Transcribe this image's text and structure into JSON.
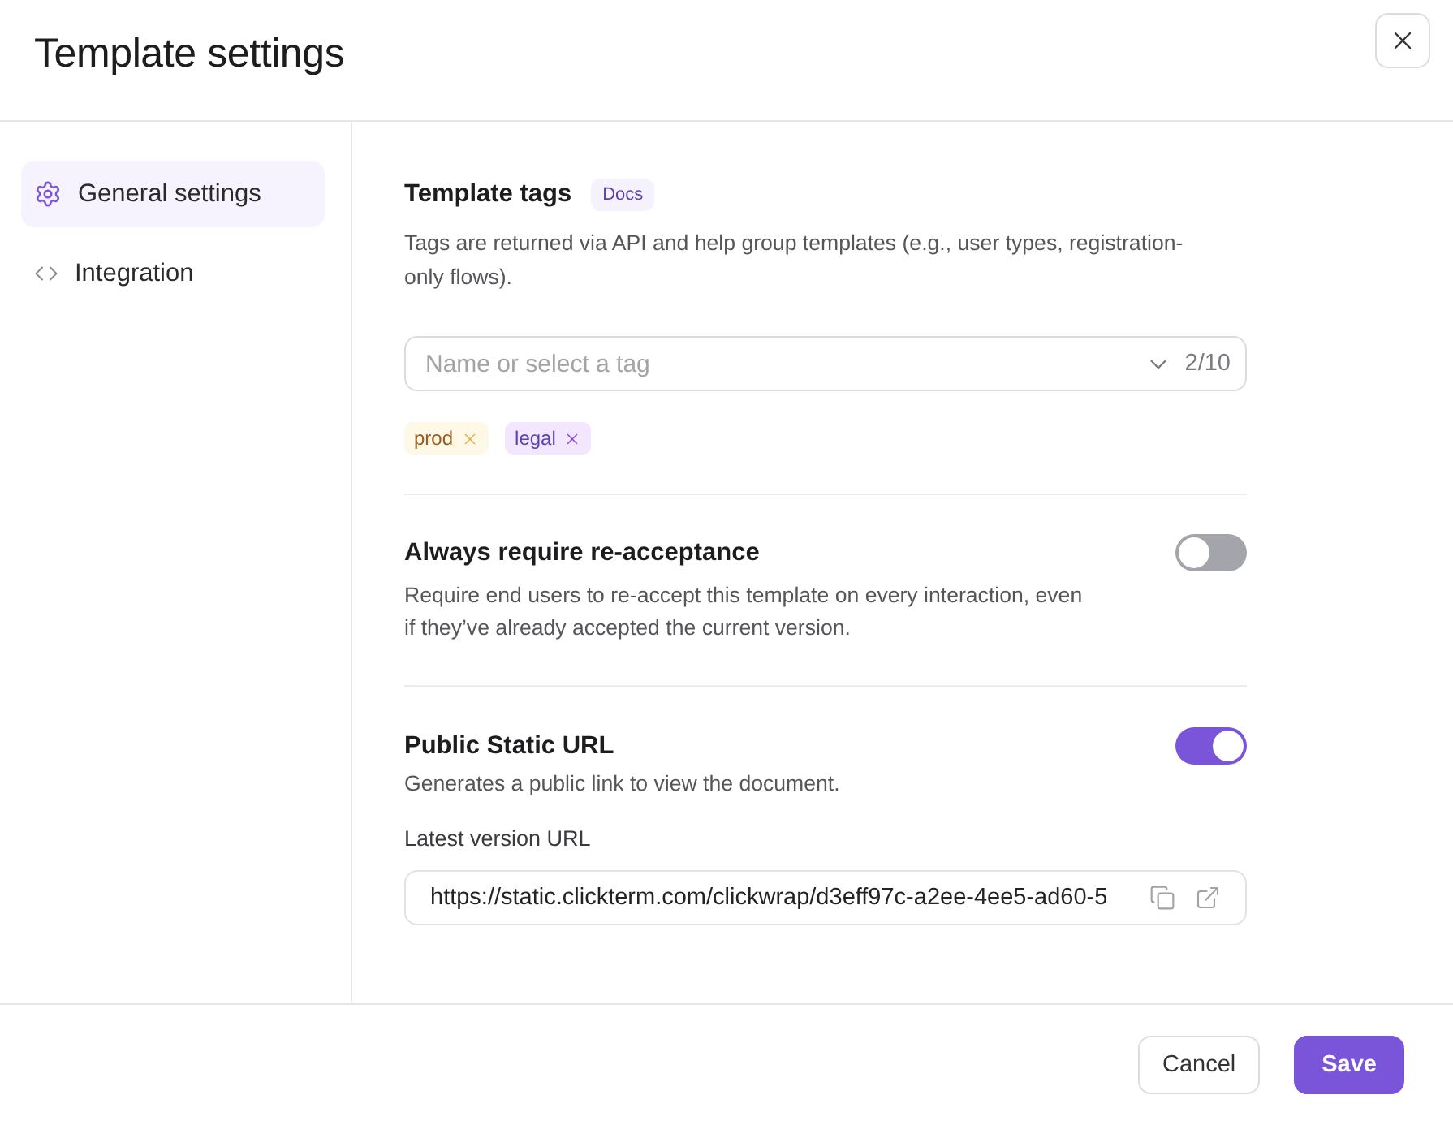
{
  "dialog": {
    "title": "Template settings"
  },
  "sidebar": {
    "items": [
      {
        "label": "General settings",
        "selected": true
      },
      {
        "label": "Integration",
        "selected": false
      }
    ]
  },
  "template_tags": {
    "title": "Template tags",
    "badge": "Docs",
    "description": "Tags are returned via API and help group templates (e.g., user types, registration-only flows).",
    "select": {
      "placeholder": "Name or select a tag",
      "count": "2/10"
    },
    "tags": [
      {
        "label": "prod",
        "color": "#9a5a1c"
      },
      {
        "label": "legal",
        "color": "#5b3fb3"
      }
    ]
  },
  "re_acceptance": {
    "title": "Always require re-acceptance",
    "description": "Require end users to re-accept this template on every interaction, even if they’ve already accepted the current version.",
    "on": false
  },
  "public_url": {
    "title": "Public Static URL",
    "description": "Generates a public link to view the document.",
    "on": true,
    "field": {
      "label": "Latest version URL",
      "value": "https://static.clickterm.com/clickwrap/d3eff97c-a2ee-4ee5-ad60-5"
    }
  },
  "footer": {
    "buttons": [
      {
        "label": "Cancel",
        "kind": "secondary"
      },
      {
        "label": "Save",
        "kind": "primary"
      }
    ]
  }
}
